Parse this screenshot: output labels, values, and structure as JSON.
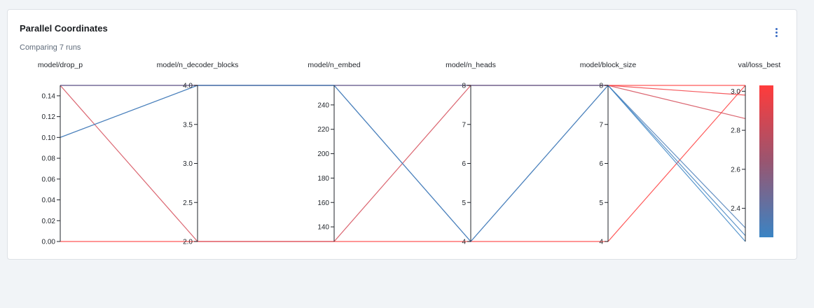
{
  "panel": {
    "title": "Parallel Coordinates",
    "subtitle": "Comparing 7 runs",
    "menu_icon": "more-vertical-icon"
  },
  "chart_data": {
    "type": "parallel-coordinates",
    "title": "Parallel Coordinates",
    "colorscale": {
      "low": "#3a84c4",
      "high": "#ff3b3b",
      "dimension": "val/loss_best"
    },
    "axes": [
      {
        "name": "model/drop_p",
        "range": [
          0,
          0.15
        ],
        "ticks": [
          0,
          0.02,
          0.04,
          0.06,
          0.08,
          0.1,
          0.12,
          0.14
        ],
        "tick_labels": [
          "0.00",
          "0.02",
          "0.04",
          "0.06",
          "0.08",
          "0.10",
          "0.12",
          "0.14"
        ]
      },
      {
        "name": "model/n_decoder_blocks",
        "range": [
          2,
          4
        ],
        "ticks": [
          2,
          2.5,
          3,
          3.5,
          4
        ],
        "tick_labels": [
          "2.0",
          "2.5",
          "3.0",
          "3.5",
          "4.0"
        ]
      },
      {
        "name": "model/n_embed",
        "range": [
          128,
          256
        ],
        "ticks": [
          140,
          160,
          180,
          200,
          220,
          240
        ],
        "tick_labels": [
          "140",
          "160",
          "180",
          "200",
          "220",
          "240"
        ]
      },
      {
        "name": "model/n_heads",
        "range": [
          4,
          8
        ],
        "ticks": [
          4,
          5,
          6,
          7,
          8
        ],
        "tick_labels": [
          "4",
          "5",
          "6",
          "7",
          "8"
        ]
      },
      {
        "name": "model/block_size",
        "range": [
          4,
          8
        ],
        "ticks": [
          4,
          5,
          6,
          7,
          8
        ],
        "tick_labels": [
          "4",
          "5",
          "6",
          "7",
          "8"
        ]
      },
      {
        "name": "val/loss_best",
        "range": [
          2.23,
          3.03
        ],
        "ticks": [
          2.4,
          2.6,
          2.8,
          3.0
        ],
        "tick_labels": [
          "2.4",
          "2.6",
          "2.8",
          "3.0"
        ]
      }
    ],
    "runs": [
      {
        "values": [
          0,
          2,
          128,
          4,
          4,
          3.03
        ]
      },
      {
        "values": [
          0.15,
          2,
          128,
          8,
          8,
          2.86
        ]
      },
      {
        "values": [
          0.15,
          4,
          256,
          8,
          8,
          3.03
        ]
      },
      {
        "values": [
          0.15,
          4,
          256,
          8,
          8,
          2.98
        ]
      },
      {
        "values": [
          0.1,
          4,
          256,
          4,
          8,
          2.23
        ]
      },
      {
        "values": [
          0.1,
          4,
          256,
          4,
          8,
          2.3
        ]
      },
      {
        "values": [
          0.15,
          4,
          256,
          8,
          8,
          2.26
        ]
      }
    ]
  }
}
